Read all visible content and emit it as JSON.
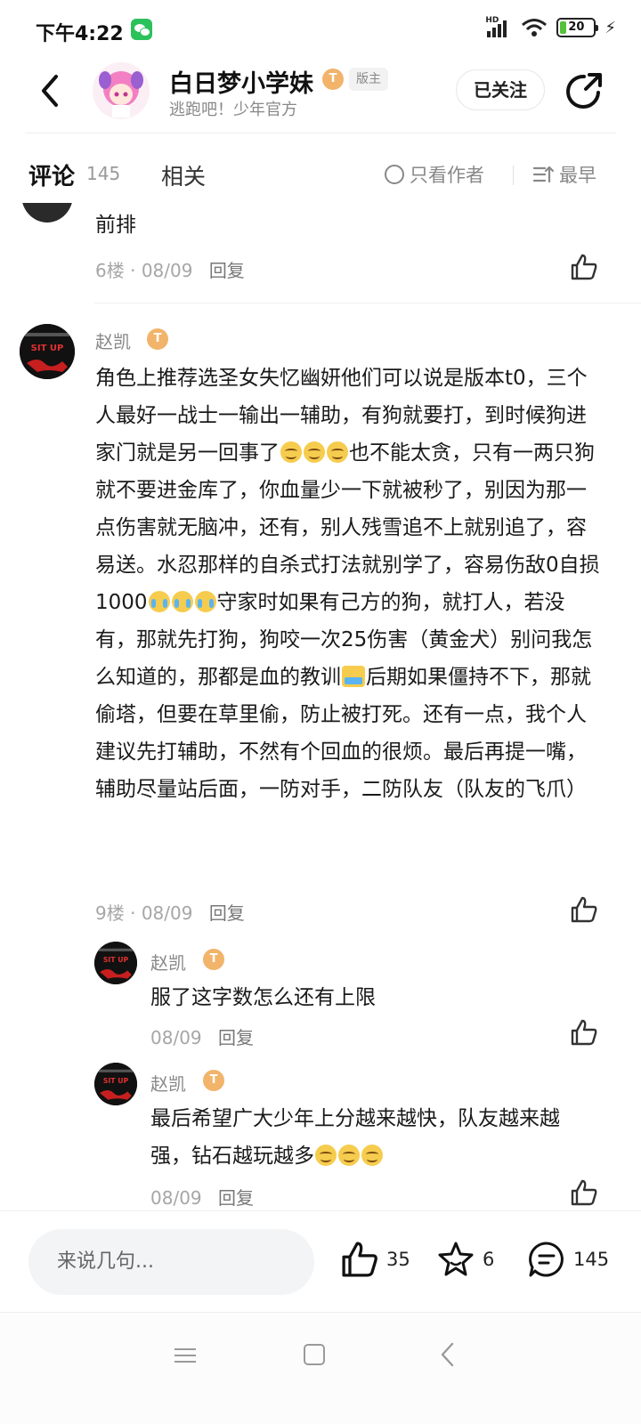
{
  "status_bar": {
    "time": "下午4:22",
    "network": "HD",
    "battery": "20",
    "battery_level": 0.2
  },
  "header": {
    "host_name": "白日梦小学妹",
    "host_level": "T",
    "host_role": "版主",
    "host_subtitle": "逃跑吧！少年官方",
    "follow_label": "已关注"
  },
  "tabs": {
    "comments_label": "评论",
    "comments_count": "145",
    "related_label": "相关",
    "only_author_label": "只看作者",
    "sort_label": "最早"
  },
  "comments": [
    {
      "text": "前排",
      "floor": "6楼",
      "date": "08/09",
      "reply_label": "回复"
    },
    {
      "user": "赵凯",
      "level": "T",
      "floor": "9楼",
      "date": "08/09",
      "reply_label": "回复",
      "text_parts": {
        "p1": "角色上推荐选圣女失忆幽妍他们可以说是版本t0，三个人最好一战士一输出一辅助，有狗就要打，到时候狗进家门就是另一回事了",
        "p2": "也不能太贪，只有一两只狗就不要进金库了，你血量少一下就被秒了，别因为那一点伤害就无脑冲，还有，别人残雪追不上就别追了，容易送。水忍那样的自杀式打法就别学了，容易伤敌0自损1000",
        "p3": "守家时如果有己方的狗，就打人，若没有，那就先打狗，狗咬一次25伤害（黄金犬）别问我怎么知道的，那都是血的教训",
        "p4": "后期如果僵持不下，那就偷塔，但要在草里偷，防止被打死。还有一点，我个人建议先打辅助，不然有个回血的很烦。最后再提一嘴，辅助尽量站后面，一防对手，二防队友（队友的飞爪）"
      },
      "replies": [
        {
          "user": "赵凯",
          "level": "T",
          "text": "服了这字数怎么还有上限",
          "date": "08/09",
          "reply_label": "回复"
        },
        {
          "user": "赵凯",
          "level": "T",
          "text": "最后希望广大少年上分越来越快，队友越来越强，钻石越玩越多",
          "date": "08/09",
          "reply_label": "回复"
        }
      ]
    }
  ],
  "avatar_badge_text": "SIT UP",
  "bottom_bar": {
    "input_placeholder": "来说几句...",
    "like_count": "35",
    "favorite_count": "6",
    "comment_count": "145"
  },
  "colors": {
    "accent": "#21d3b8",
    "level_badge": "#f1b46a",
    "battery": "#53c23a",
    "wechat": "#2bc15b"
  },
  "icons": [
    "back-arrow-icon",
    "share-icon",
    "radio-icon",
    "sort-icon",
    "thumbs-up-icon",
    "star-icon",
    "comment-bubble-icon",
    "wechat-icon"
  ]
}
